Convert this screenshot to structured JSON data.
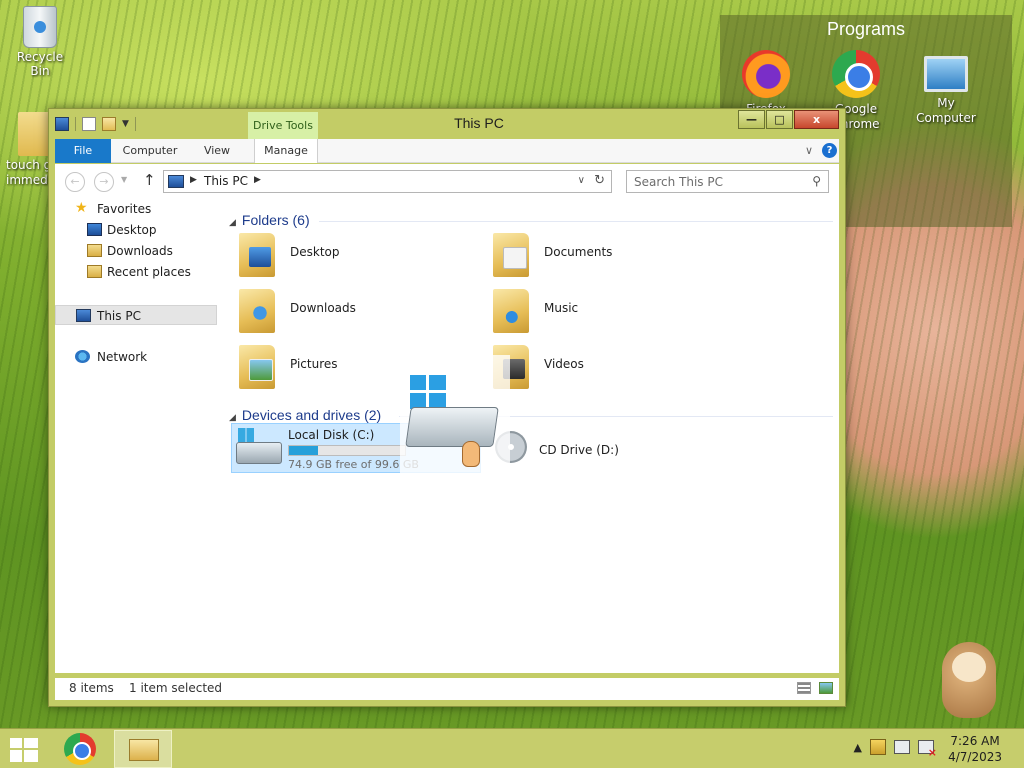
{
  "desktop": {
    "recycle_bin_label": "Recycle Bin",
    "touch_label_line1": "touch g",
    "touch_label_line2": "immed"
  },
  "programs_panel": {
    "title": "Programs",
    "items": [
      {
        "label": "Firefox",
        "icon": "firefox-icon"
      },
      {
        "label": "Google Chrome",
        "icon": "chrome-icon"
      },
      {
        "label": "My Computer",
        "icon": "my-computer-icon"
      }
    ]
  },
  "window": {
    "title": "This PC",
    "contextual_tab_group": "Drive Tools",
    "buttons": {
      "minimize": "—",
      "maximize": "□",
      "close": "x"
    },
    "ribbon_tabs": {
      "file": "File",
      "computer": "Computer",
      "view": "View",
      "manage": "Manage"
    },
    "help": "?",
    "address": {
      "path": "This PC"
    },
    "search": {
      "placeholder": "Search This PC"
    },
    "nav_pane": {
      "favorites": "Favorites",
      "desktop": "Desktop",
      "downloads": "Downloads",
      "recent": "Recent places",
      "this_pc": "This PC",
      "network": "Network"
    },
    "folders_header": "Folders (6)",
    "folders": [
      {
        "label": "Desktop",
        "icon": "desktop-folder-icon"
      },
      {
        "label": "Documents",
        "icon": "documents-folder-icon"
      },
      {
        "label": "Downloads",
        "icon": "downloads-folder-icon"
      },
      {
        "label": "Music",
        "icon": "music-folder-icon"
      },
      {
        "label": "Pictures",
        "icon": "pictures-folder-icon"
      },
      {
        "label": "Videos",
        "icon": "videos-folder-icon"
      }
    ],
    "drives_header": "Devices and drives (2)",
    "drives": {
      "local": {
        "name": "Local Disk (C:)",
        "free": "74.9 GB free of 99.6 GB",
        "used_fraction": 0.248
      },
      "cd": {
        "name": "CD Drive (D:)"
      }
    },
    "status": {
      "items": "8 items",
      "selected": "1 item selected"
    }
  },
  "taskbar": {
    "clock_time": "7:26 AM",
    "clock_date": "4/7/2023",
    "tray_arrow": "▲"
  },
  "colors": {
    "accent": "#1979ca",
    "selection": "#cce8ff",
    "taskbar": "#c6cd6c",
    "drive_fill": "#26a0da"
  }
}
